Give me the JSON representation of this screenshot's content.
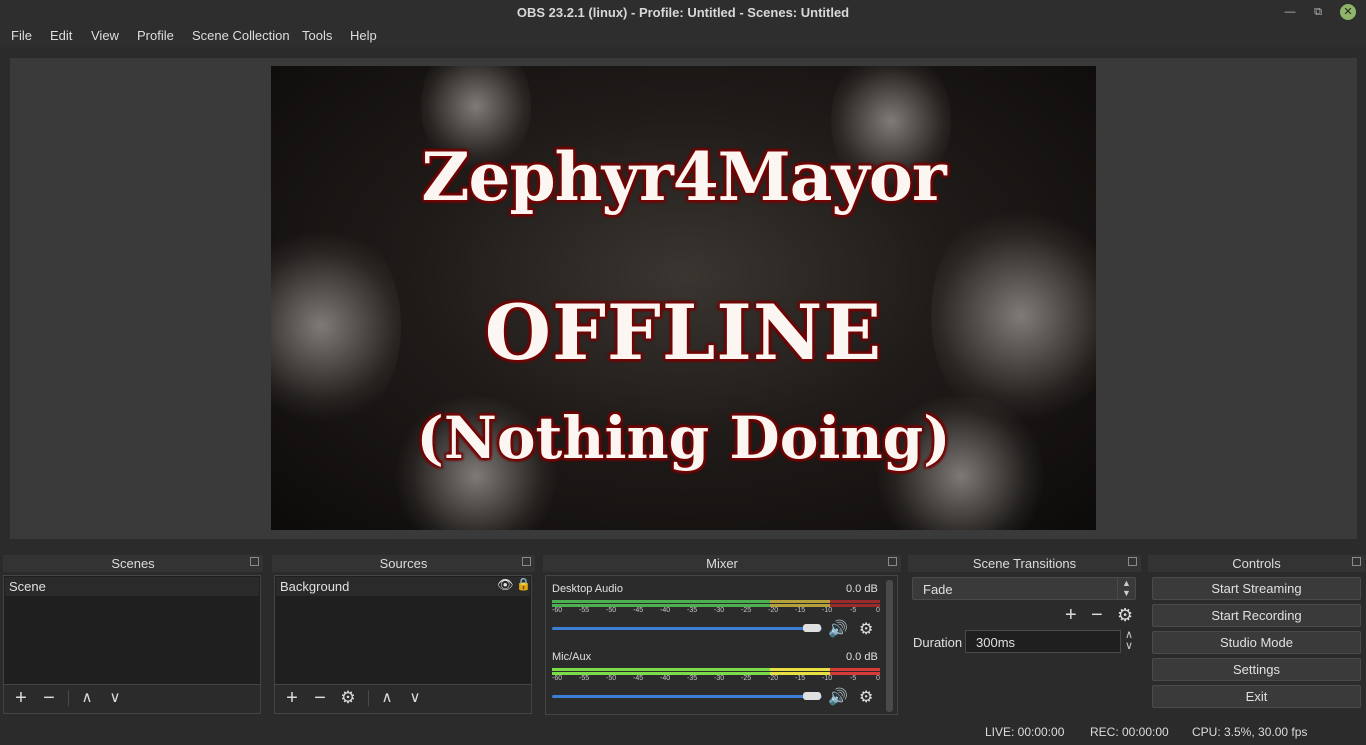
{
  "window": {
    "title": "OBS 23.2.1 (linux) - Profile: Untitled - Scenes: Untitled",
    "minimize_icon": "minimize-icon",
    "maximize_icon": "restore-icon",
    "close_icon": "close-icon"
  },
  "menu": [
    "File",
    "Edit",
    "View",
    "Profile",
    "Scene Collection",
    "Tools",
    "Help"
  ],
  "preview": {
    "line1": "Zephyr4Mayor",
    "line2": "OFFLINE",
    "line3": "(Nothing Doing)"
  },
  "docks": {
    "scenes": {
      "title": "Scenes",
      "items": [
        "Scene"
      ]
    },
    "sources": {
      "title": "Sources",
      "items": [
        "Background"
      ]
    },
    "mixer": {
      "title": "Mixer"
    },
    "transitions": {
      "title": "Scene Transitions"
    },
    "controls": {
      "title": "Controls"
    }
  },
  "mixer": {
    "channels": [
      {
        "name": "Desktop Audio",
        "db": "0.0 dB"
      },
      {
        "name": "Mic/Aux",
        "db": "0.0 dB"
      }
    ],
    "scale": [
      "-60",
      "-55",
      "-50",
      "-45",
      "-40",
      "-35",
      "-30",
      "-25",
      "-20",
      "-15",
      "-10",
      "-5",
      "0"
    ]
  },
  "transitions": {
    "selected": "Fade",
    "duration_label": "Duration",
    "duration_value": "300ms"
  },
  "controls": {
    "start_streaming": "Start Streaming",
    "start_recording": "Start Recording",
    "studio_mode": "Studio Mode",
    "settings": "Settings",
    "exit": "Exit"
  },
  "status": {
    "live": "LIVE: 00:00:00",
    "rec": "REC: 00:00:00",
    "cpu": "CPU: 3.5%, 30.00 fps"
  },
  "colors": {
    "accent_blue": "#3d7fd6",
    "meter_green": "#4caf50",
    "meter_yellow": "#b5a03a",
    "meter_red": "#9a2b2b"
  }
}
